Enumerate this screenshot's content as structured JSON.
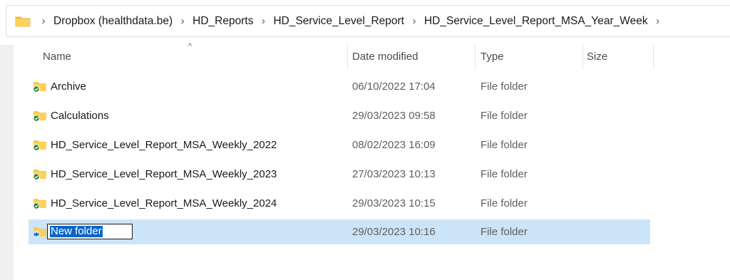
{
  "breadcrumb": {
    "items": [
      "Dropbox (healthdata.be)",
      "HD_Reports",
      "HD_Service_Level_Report",
      "HD_Service_Level_Report_MSA_Year_Week"
    ],
    "separator": "›"
  },
  "columns": {
    "name": "Name",
    "date_modified": "Date modified",
    "type": "Type",
    "size": "Size"
  },
  "files": [
    {
      "name": "Archive",
      "date_modified": "06/10/2022 17:04",
      "type": "File folder",
      "sync_status": "synced"
    },
    {
      "name": "Calculations",
      "date_modified": "29/03/2023 09:58",
      "type": "File folder",
      "sync_status": "synced"
    },
    {
      "name": "HD_Service_Level_Report_MSA_Weekly_2022",
      "date_modified": "08/02/2023 16:09",
      "type": "File folder",
      "sync_status": "synced"
    },
    {
      "name": "HD_Service_Level_Report_MSA_Weekly_2023",
      "date_modified": "27/03/2023 10:13",
      "type": "File folder",
      "sync_status": "synced"
    },
    {
      "name": "HD_Service_Level_Report_MSA_Weekly_2024",
      "date_modified": "29/03/2023 10:15",
      "type": "File folder",
      "sync_status": "synced"
    },
    {
      "name": "New folder",
      "date_modified": "29/03/2023 10:16",
      "type": "File folder",
      "sync_status": "syncing",
      "selected": true,
      "renaming": true
    }
  ],
  "colors": {
    "folder": "#f8c74a",
    "synced_badge": "#2e7d32",
    "syncing_badge": "#1565c0",
    "selection": "#cce4f7"
  }
}
